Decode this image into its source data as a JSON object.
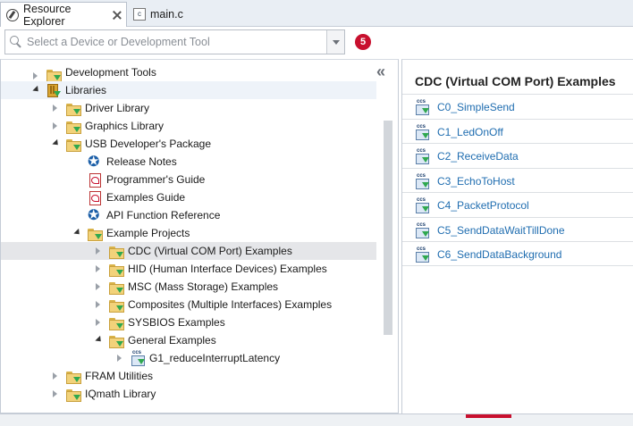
{
  "tabs": [
    {
      "label": "Resource Explorer",
      "icon": "compass-icon",
      "active": true
    },
    {
      "label": "main.c",
      "icon": "c-file-icon",
      "active": false
    }
  ],
  "search": {
    "placeholder": "Select a Device or Development Tool",
    "value": ""
  },
  "notification_badge": "5",
  "tree": [
    {
      "label": "Development Tools",
      "icon": "folder-icon",
      "twisty": "closed",
      "depth": 1
    },
    {
      "label": "Libraries",
      "icon": "library-icon",
      "twisty": "open",
      "depth": 1
    },
    {
      "label": "Driver Library",
      "icon": "folder-icon",
      "twisty": "closed",
      "depth": 2
    },
    {
      "label": "Graphics Library",
      "icon": "folder-icon",
      "twisty": "closed",
      "depth": 2
    },
    {
      "label": "USB Developer's Package",
      "icon": "folder-icon",
      "twisty": "open",
      "depth": 2
    },
    {
      "label": "Release Notes",
      "icon": "star-icon",
      "twisty": "none",
      "depth": 3
    },
    {
      "label": "Programmer's Guide",
      "icon": "pdf-icon",
      "twisty": "none",
      "depth": 3
    },
    {
      "label": "Examples Guide",
      "icon": "pdf-icon",
      "twisty": "none",
      "depth": 3
    },
    {
      "label": "API Function Reference",
      "icon": "star-icon",
      "twisty": "none",
      "depth": 3
    },
    {
      "label": "Example Projects",
      "icon": "folder-icon",
      "twisty": "open",
      "depth": 3
    },
    {
      "label": "CDC (Virtual COM Port) Examples",
      "icon": "folder-icon",
      "twisty": "closed",
      "depth": 4,
      "selected": true
    },
    {
      "label": "HID (Human Interface Devices) Examples",
      "icon": "folder-icon",
      "twisty": "closed",
      "depth": 4
    },
    {
      "label": "MSC (Mass Storage) Examples",
      "icon": "folder-icon",
      "twisty": "closed",
      "depth": 4
    },
    {
      "label": "Composites (Multiple Interfaces) Examples",
      "icon": "folder-icon",
      "twisty": "closed",
      "depth": 4
    },
    {
      "label": "SYSBIOS Examples",
      "icon": "folder-icon",
      "twisty": "closed",
      "depth": 4
    },
    {
      "label": "General Examples",
      "icon": "folder-icon",
      "twisty": "open",
      "depth": 4
    },
    {
      "label": "G1_reduceInterruptLatency",
      "icon": "ccs-project-icon",
      "twisty": "closed",
      "depth": 5
    },
    {
      "label": "FRAM Utilities",
      "icon": "folder-icon",
      "twisty": "closed",
      "depth": 2
    },
    {
      "label": "IQmath Library",
      "icon": "folder-icon",
      "twisty": "closed",
      "depth": 2
    }
  ],
  "details": {
    "title": "CDC (Virtual COM Port) Examples",
    "items": [
      {
        "label": "C0_SimpleSend",
        "icon": "ccs-project-icon"
      },
      {
        "label": "C1_LedOnOff",
        "icon": "ccs-project-icon"
      },
      {
        "label": "C2_ReceiveData",
        "icon": "ccs-project-icon"
      },
      {
        "label": "C3_EchoToHost",
        "icon": "ccs-project-icon"
      },
      {
        "label": "C4_PacketProtocol",
        "icon": "ccs-project-icon"
      },
      {
        "label": "C5_SendDataWaitTillDone",
        "icon": "ccs-project-icon"
      },
      {
        "label": "C6_SendDataBackground",
        "icon": "ccs-project-icon"
      }
    ]
  },
  "colors": {
    "accent": "#c8102e",
    "link": "#1f6db0",
    "selection": "#e5e6e9"
  }
}
